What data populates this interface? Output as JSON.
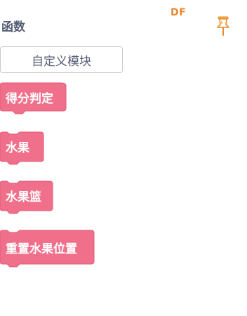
{
  "palette": {
    "category_title": "函数",
    "make_block_label": "自定义模块",
    "logo_text": "DF",
    "blocks": [
      {
        "label": "得分判定"
      },
      {
        "label": "水果"
      },
      {
        "label": "水果篮"
      },
      {
        "label": "重置水果位置"
      }
    ]
  },
  "icons": {
    "pin": "pin-icon"
  },
  "colors": {
    "block_fill": "#f0708b",
    "block_stroke": "#e05a76",
    "category_text": "#575e75",
    "logo": "#e8892f"
  }
}
